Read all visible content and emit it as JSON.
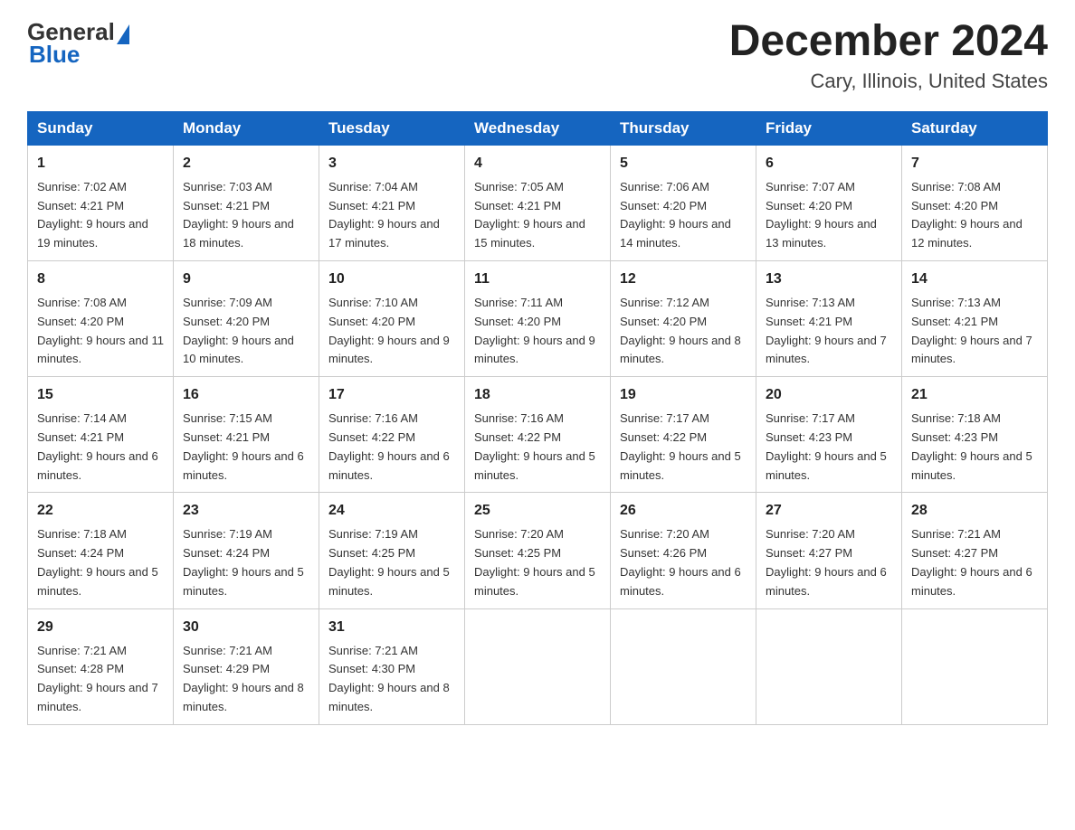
{
  "logo": {
    "general": "General",
    "blue": "Blue"
  },
  "title": {
    "month": "December 2024",
    "location": "Cary, Illinois, United States"
  },
  "headers": [
    "Sunday",
    "Monday",
    "Tuesday",
    "Wednesday",
    "Thursday",
    "Friday",
    "Saturday"
  ],
  "weeks": [
    [
      {
        "day": "1",
        "sunrise": "7:02 AM",
        "sunset": "4:21 PM",
        "daylight": "9 hours and 19 minutes."
      },
      {
        "day": "2",
        "sunrise": "7:03 AM",
        "sunset": "4:21 PM",
        "daylight": "9 hours and 18 minutes."
      },
      {
        "day": "3",
        "sunrise": "7:04 AM",
        "sunset": "4:21 PM",
        "daylight": "9 hours and 17 minutes."
      },
      {
        "day": "4",
        "sunrise": "7:05 AM",
        "sunset": "4:21 PM",
        "daylight": "9 hours and 15 minutes."
      },
      {
        "day": "5",
        "sunrise": "7:06 AM",
        "sunset": "4:20 PM",
        "daylight": "9 hours and 14 minutes."
      },
      {
        "day": "6",
        "sunrise": "7:07 AM",
        "sunset": "4:20 PM",
        "daylight": "9 hours and 13 minutes."
      },
      {
        "day": "7",
        "sunrise": "7:08 AM",
        "sunset": "4:20 PM",
        "daylight": "9 hours and 12 minutes."
      }
    ],
    [
      {
        "day": "8",
        "sunrise": "7:08 AM",
        "sunset": "4:20 PM",
        "daylight": "9 hours and 11 minutes."
      },
      {
        "day": "9",
        "sunrise": "7:09 AM",
        "sunset": "4:20 PM",
        "daylight": "9 hours and 10 minutes."
      },
      {
        "day": "10",
        "sunrise": "7:10 AM",
        "sunset": "4:20 PM",
        "daylight": "9 hours and 9 minutes."
      },
      {
        "day": "11",
        "sunrise": "7:11 AM",
        "sunset": "4:20 PM",
        "daylight": "9 hours and 9 minutes."
      },
      {
        "day": "12",
        "sunrise": "7:12 AM",
        "sunset": "4:20 PM",
        "daylight": "9 hours and 8 minutes."
      },
      {
        "day": "13",
        "sunrise": "7:13 AM",
        "sunset": "4:21 PM",
        "daylight": "9 hours and 7 minutes."
      },
      {
        "day": "14",
        "sunrise": "7:13 AM",
        "sunset": "4:21 PM",
        "daylight": "9 hours and 7 minutes."
      }
    ],
    [
      {
        "day": "15",
        "sunrise": "7:14 AM",
        "sunset": "4:21 PM",
        "daylight": "9 hours and 6 minutes."
      },
      {
        "day": "16",
        "sunrise": "7:15 AM",
        "sunset": "4:21 PM",
        "daylight": "9 hours and 6 minutes."
      },
      {
        "day": "17",
        "sunrise": "7:16 AM",
        "sunset": "4:22 PM",
        "daylight": "9 hours and 6 minutes."
      },
      {
        "day": "18",
        "sunrise": "7:16 AM",
        "sunset": "4:22 PM",
        "daylight": "9 hours and 5 minutes."
      },
      {
        "day": "19",
        "sunrise": "7:17 AM",
        "sunset": "4:22 PM",
        "daylight": "9 hours and 5 minutes."
      },
      {
        "day": "20",
        "sunrise": "7:17 AM",
        "sunset": "4:23 PM",
        "daylight": "9 hours and 5 minutes."
      },
      {
        "day": "21",
        "sunrise": "7:18 AM",
        "sunset": "4:23 PM",
        "daylight": "9 hours and 5 minutes."
      }
    ],
    [
      {
        "day": "22",
        "sunrise": "7:18 AM",
        "sunset": "4:24 PM",
        "daylight": "9 hours and 5 minutes."
      },
      {
        "day": "23",
        "sunrise": "7:19 AM",
        "sunset": "4:24 PM",
        "daylight": "9 hours and 5 minutes."
      },
      {
        "day": "24",
        "sunrise": "7:19 AM",
        "sunset": "4:25 PM",
        "daylight": "9 hours and 5 minutes."
      },
      {
        "day": "25",
        "sunrise": "7:20 AM",
        "sunset": "4:25 PM",
        "daylight": "9 hours and 5 minutes."
      },
      {
        "day": "26",
        "sunrise": "7:20 AM",
        "sunset": "4:26 PM",
        "daylight": "9 hours and 6 minutes."
      },
      {
        "day": "27",
        "sunrise": "7:20 AM",
        "sunset": "4:27 PM",
        "daylight": "9 hours and 6 minutes."
      },
      {
        "day": "28",
        "sunrise": "7:21 AM",
        "sunset": "4:27 PM",
        "daylight": "9 hours and 6 minutes."
      }
    ],
    [
      {
        "day": "29",
        "sunrise": "7:21 AM",
        "sunset": "4:28 PM",
        "daylight": "9 hours and 7 minutes."
      },
      {
        "day": "30",
        "sunrise": "7:21 AM",
        "sunset": "4:29 PM",
        "daylight": "9 hours and 8 minutes."
      },
      {
        "day": "31",
        "sunrise": "7:21 AM",
        "sunset": "4:30 PM",
        "daylight": "9 hours and 8 minutes."
      },
      null,
      null,
      null,
      null
    ]
  ]
}
